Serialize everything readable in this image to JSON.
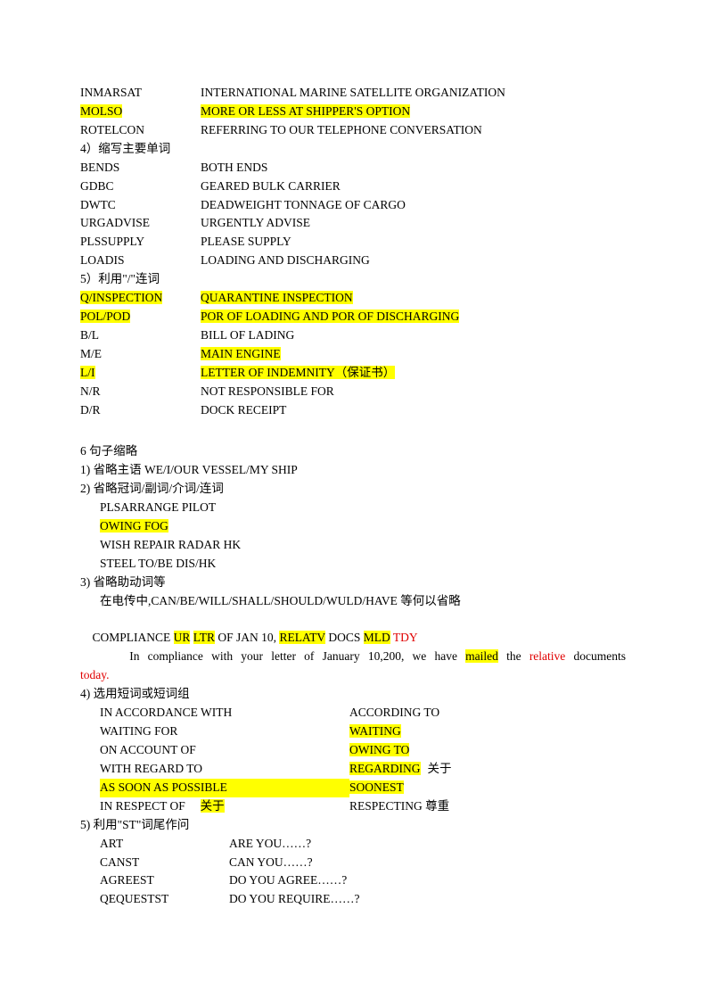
{
  "topTable": [
    {
      "abbr": "INMARSAT",
      "def": "INTERNATIONAL MARINE SATELLITE ORGANIZATION",
      "hlAbbr": false,
      "hlDef": false
    },
    {
      "abbr": "MOLSO",
      "def": "MORE OR LESS AT SHIPPER'S OPTION",
      "hlAbbr": true,
      "hlDef": true
    },
    {
      "abbr": "ROTELCON",
      "def": " REFERRING TO OUR TELEPHONE CONVERSATION",
      "hlAbbr": false,
      "hlDef": false
    }
  ],
  "sectionHeaders": {
    "s4": "4）缩写主要单词",
    "s5": "5）利用\"/\"连词",
    "s6": "6  句子缩略",
    "s6_1": "1)   省略主语 WE/I/OUR VESSEL/MY SHIP",
    "s6_2": "2)   省略冠词/副词/介词/连词",
    "s6_3": "3)   省略助动词等",
    "s6_4": "4)   选用短词或短词组",
    "s6_5": "5)   利用\"ST\"词尾作问"
  },
  "table4": [
    {
      "abbr": "BENDS",
      "def": "BOTH ENDS",
      "hlAbbr": false,
      "hlDef": false
    },
    {
      "abbr": "GDBC",
      "def": "GEARED BULK CARRIER",
      "hlAbbr": false,
      "hlDef": false
    },
    {
      "abbr": "DWTC",
      "def": " DEADWEIGHT TONNAGE OF CARGO",
      "hlAbbr": false,
      "hlDef": false
    },
    {
      "abbr": "URGADVISE",
      "def": "URGENTLY ADVISE",
      "hlAbbr": false,
      "hlDef": false
    },
    {
      "abbr": "PLSSUPPLY",
      "def": " PLEASE SUPPLY",
      "hlAbbr": false,
      "hlDef": false
    },
    {
      "abbr": "LOADIS",
      "def": "LOADING AND DISCHARGING",
      "hlAbbr": false,
      "hlDef": false
    }
  ],
  "table5": [
    {
      "abbr": "Q/INSPECTION",
      "def": "QUARANTINE INSPECTION",
      "hlAbbr": true,
      "hlDef": true
    },
    {
      "abbr": "POL/POD",
      "def": "POR OF LOADING AND POR OF DISCHARGING",
      "hlAbbr": true,
      "hlDef": true
    },
    {
      "abbr": "B/L",
      "def": "BILL OF LADING",
      "hlAbbr": false,
      "hlDef": false
    },
    {
      "abbr": "M/E",
      "def": " MAIN ENGINE",
      "hlAbbr": false,
      "hlDef": true,
      "defGap": true
    },
    {
      "abbr": "L/I",
      "def": " LETTER OF INDEMNITY（保证书）",
      "hlAbbr": true,
      "hlDef": true,
      "defGap": true
    },
    {
      "abbr": "N/R",
      "def": "NOT RESPONSIBLE FOR",
      "hlAbbr": false,
      "hlDef": false
    },
    {
      "abbr": "D/R",
      "def": "DOCK RECEIPT",
      "hlAbbr": false,
      "hlDef": false
    }
  ],
  "lines6_2": {
    "l1": "PLSARRANGE PILOT",
    "l2": "OWING FOG",
    "l3": "WISH REPAIR RADAR HK",
    "l4": "STEEL TO/BE DIS/HK"
  },
  "lines6_3": {
    "l1": "在电传中,CAN/BE/WILL/SHALL/SHOULD/WULD/HAVE 等何以省略",
    "comp_pre": "    COMPLIANCE ",
    "comp_ur": "UR",
    "comp_sp1": " ",
    "comp_ltr": "LTR",
    "comp_of": " OF JAN 10, ",
    "comp_rel": "RELATV",
    "comp_docs": " DOCS ",
    "comp_mld": "MLD",
    "comp_sp2": " ",
    "comp_tdy": "TDY",
    "expl_pre": "      In compliance with your letter of January 10,200, we have ",
    "expl_mailed": "mailed",
    "expl_mid": " the ",
    "expl_relative": "relative",
    "expl_docs": " documents",
    "today": "today."
  },
  "pairs6_4": [
    {
      "l": "IN ACCORDANCE WITH",
      "r": "ACCORDING TO",
      "hlL": false,
      "hlR": false,
      "note": ""
    },
    {
      "l": "WAITING FOR",
      "r": "WAITING",
      "hlL": false,
      "hlR": true,
      "note": ""
    },
    {
      "l": "ON ACCOUNT OF",
      "r": "OWING TO",
      "hlL": false,
      "hlR": true,
      "note": ""
    },
    {
      "l": "WITH REGARD TO",
      "r": "REGARDING",
      "hlL": false,
      "hlR": true,
      "note": "关于"
    },
    {
      "l": "AS SOON AS POSSIBLE",
      "r": "SOONEST",
      "hlL": true,
      "hlR": true,
      "fillGap": true,
      "note": ""
    }
  ],
  "resp_left": "IN RESPECT OF",
  "resp_about": "关于",
  "resp_right": "RESPECTING 尊重",
  "table6_5": [
    {
      "l": "ART",
      "r": "ARE YOU……?"
    },
    {
      "l": "CANST",
      "r": "CAN YOU……?"
    },
    {
      "l": "AGREEST",
      "r": "DO YOU AGREE……?"
    },
    {
      "l": "QEQUESTST",
      "r": "DO YOU REQUIRE……?"
    }
  ]
}
